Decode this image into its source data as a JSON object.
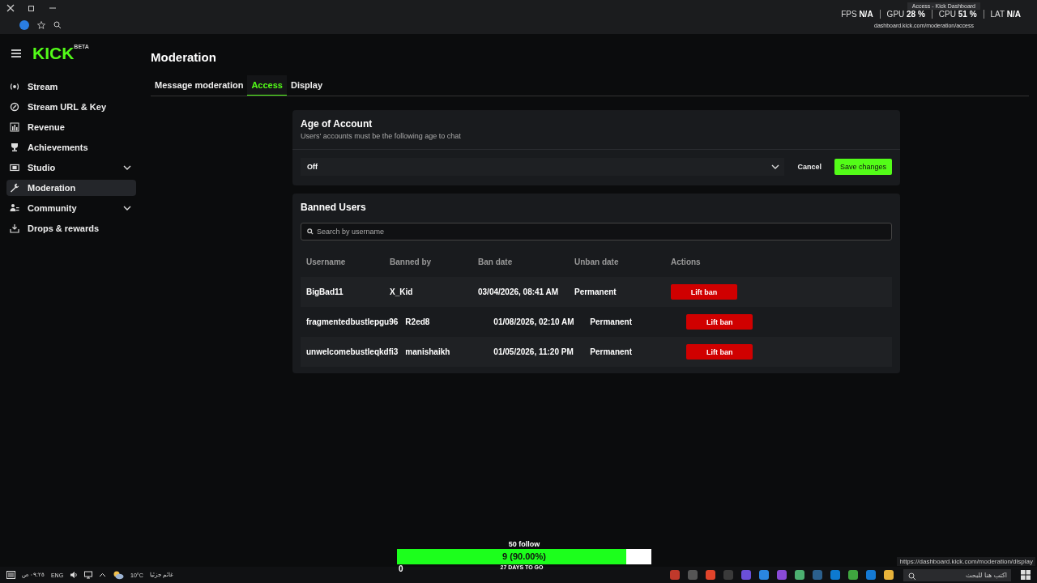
{
  "browser": {
    "tab_title": "Access - Kick Dashboard",
    "url": "dashboard.kick.com/moderation/access",
    "stats": [
      {
        "label": "FPS",
        "value": "N/A"
      },
      {
        "label": "GPU",
        "value": "28 %"
      },
      {
        "label": "CPU",
        "value": "51 %"
      },
      {
        "label": "LAT",
        "value": "N/A"
      }
    ]
  },
  "logo": {
    "text": "KICK",
    "badge": "BETA"
  },
  "sidebar": {
    "items": [
      {
        "label": "Stream",
        "selected": false,
        "expandable": false
      },
      {
        "label": "Stream URL & Key",
        "selected": false,
        "expandable": false
      },
      {
        "label": "Revenue",
        "selected": false,
        "expandable": false
      },
      {
        "label": "Achievements",
        "selected": false,
        "expandable": false
      },
      {
        "label": "Studio",
        "selected": false,
        "expandable": true
      },
      {
        "label": "Moderation",
        "selected": true,
        "expandable": false
      },
      {
        "label": "Community",
        "selected": false,
        "expandable": true
      },
      {
        "label": "Drops & rewards",
        "selected": false,
        "expandable": false
      }
    ]
  },
  "page": {
    "title": "Moderation",
    "tabs": [
      {
        "label": "Message moderation",
        "selected": false
      },
      {
        "label": "Access",
        "selected": true
      },
      {
        "label": "Display",
        "selected": false
      }
    ]
  },
  "age_of_account": {
    "title": "Age of Account",
    "description": "Users' accounts must be the following age to chat",
    "value": "Off",
    "buttons": {
      "cancel": "Cancel",
      "save": "Save changes"
    }
  },
  "banned_users": {
    "title": "Banned Users",
    "search_placeholder": "Search by username",
    "columns": [
      "Username",
      "Banned by",
      "Ban date",
      "Unban date",
      "Actions"
    ],
    "rows": [
      {
        "username": "BigBad11",
        "banned_by": "X_Kid",
        "ban_date": "03/04/2026, 08:41 AM",
        "unban_date": "Permanent",
        "action": "Lift ban"
      },
      {
        "username": "fragmentedbustlepgu96",
        "banned_by": "R2ed8",
        "ban_date": "01/08/2026, 02:10 AM",
        "unban_date": "Permanent",
        "action": "Lift ban"
      },
      {
        "username": "unwelcomebustleqkdfi3",
        "banned_by": "manishaikh",
        "ban_date": "01/05/2026, 11:20 PM",
        "unban_date": "Permanent",
        "action": "Lift ban"
      }
    ]
  },
  "follow_goal": {
    "title": "50 follow",
    "progress": "9 (90.00%)",
    "level": 0.9,
    "start": "0",
    "remaining": "27 DAYS TO GO"
  },
  "taskbar": {
    "time": "٠٩:٢٥ ص",
    "language": "ENG",
    "temperature": "10°C",
    "weather": "غائم جزئيا",
    "search_placeholder": "اكتب هنا للبحث",
    "link_preview": "https://dashboard.kick.com/moderation/display"
  }
}
